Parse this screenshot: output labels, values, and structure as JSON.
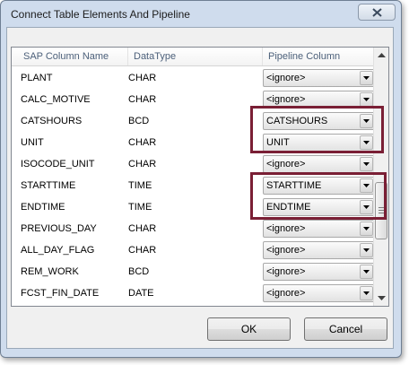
{
  "window": {
    "title": "Connect Table Elements And Pipeline"
  },
  "columns": {
    "sap_column_name": "SAP Column Name",
    "data_type": "DataType",
    "pipeline_column": "Pipeline Column"
  },
  "rows": [
    {
      "name": "PLANT",
      "type": "CHAR",
      "pipeline": "<ignore>"
    },
    {
      "name": "CALC_MOTIVE",
      "type": "CHAR",
      "pipeline": "<ignore>"
    },
    {
      "name": "CATSHOURS",
      "type": "BCD",
      "pipeline": "CATSHOURS"
    },
    {
      "name": "UNIT",
      "type": "CHAR",
      "pipeline": "UNIT"
    },
    {
      "name": "ISOCODE_UNIT",
      "type": "CHAR",
      "pipeline": "<ignore>"
    },
    {
      "name": "STARTTIME",
      "type": "TIME",
      "pipeline": "STARTTIME"
    },
    {
      "name": "ENDTIME",
      "type": "TIME",
      "pipeline": "ENDTIME"
    },
    {
      "name": "PREVIOUS_DAY",
      "type": "CHAR",
      "pipeline": "<ignore>"
    },
    {
      "name": "ALL_DAY_FLAG",
      "type": "CHAR",
      "pipeline": "<ignore>"
    },
    {
      "name": "REM_WORK",
      "type": "BCD",
      "pipeline": "<ignore>"
    },
    {
      "name": "FCST_FIN_DATE",
      "type": "DATE",
      "pipeline": "<ignore>"
    },
    {
      "name": "",
      "type": "",
      "pipeline": ""
    }
  ],
  "buttons": {
    "ok": "OK",
    "cancel": "Cancel"
  },
  "colors": {
    "highlight": "#7a1f35",
    "window_frame": "#cfdced"
  }
}
